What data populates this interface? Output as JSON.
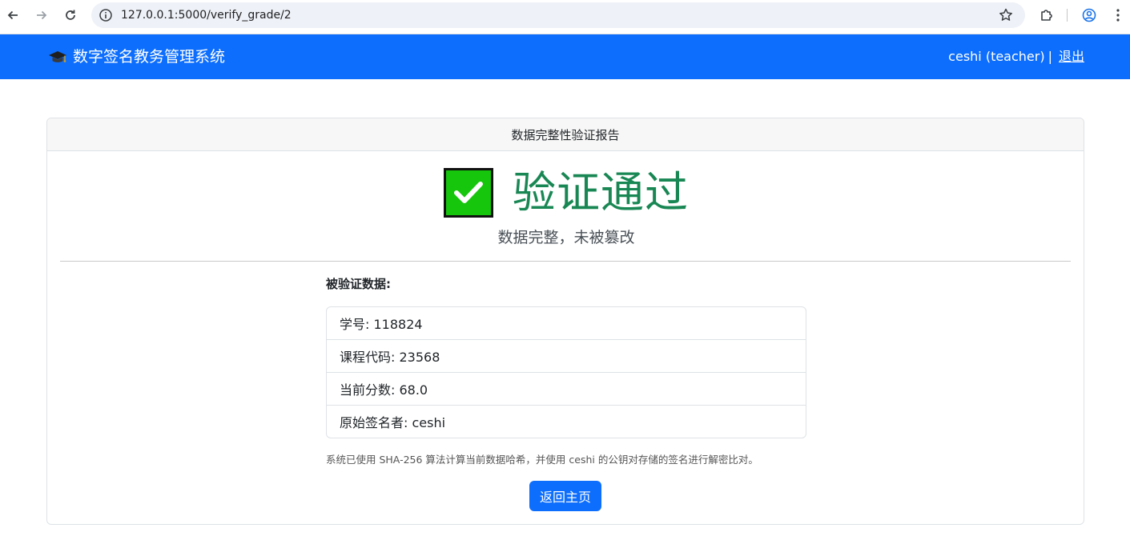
{
  "browser": {
    "url": "127.0.0.1:5000/verify_grade/2"
  },
  "navbar": {
    "brand_title": "数字签名教务管理系统",
    "user_label": "ceshi (teacher)",
    "separator": "|",
    "logout_label": "退出"
  },
  "card": {
    "header_title": "数据完整性验证报告",
    "status_title": "验证通过",
    "status_subtitle": "数据完整，未被篡改",
    "section_label": "被验证数据:",
    "items": [
      {
        "text": "学号: 118824"
      },
      {
        "text": "课程代码: 23568"
      },
      {
        "text": "当前分数: 68.0"
      },
      {
        "text": "原始签名者: ceshi"
      }
    ],
    "note": "系统已使用 SHA-256 算法计算当前数据哈希，并使用 ceshi 的公钥对存储的签名进行解密比对。",
    "home_button_label": "返回主页"
  },
  "colors": {
    "primary": "#0d6efd",
    "success_text": "#198754",
    "check_green": "#16c60c"
  },
  "icons": {
    "brand": "graduation-cap-icon",
    "status": "check-mark-button-icon"
  }
}
